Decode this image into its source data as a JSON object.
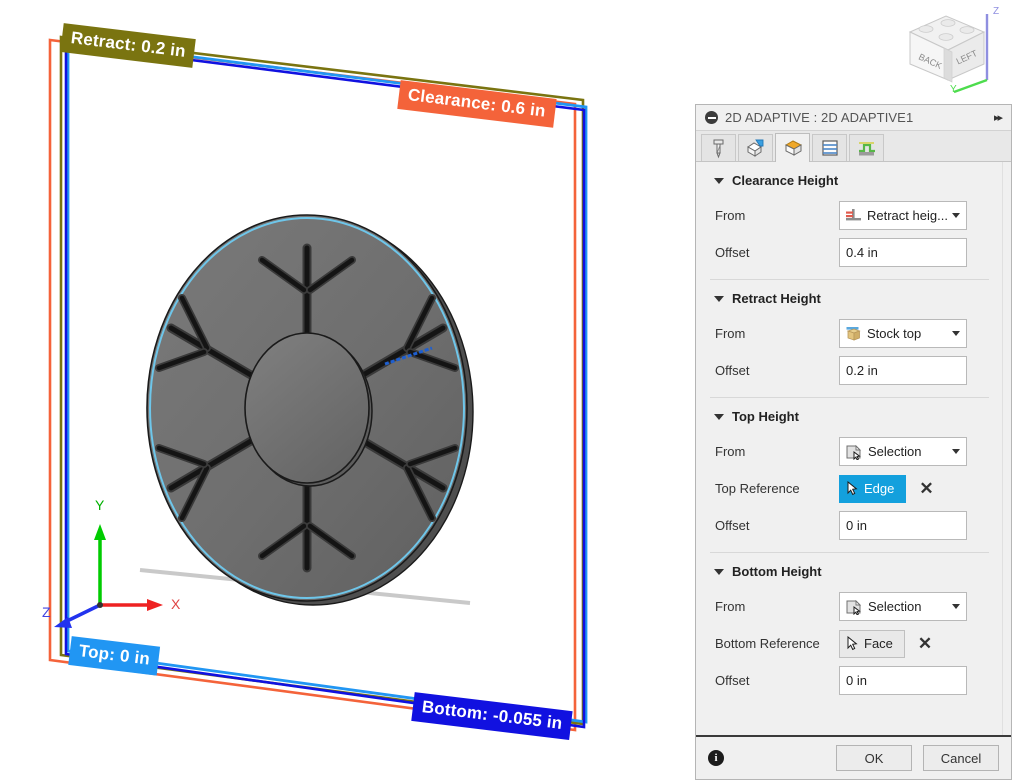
{
  "viewport": {
    "labels": [
      {
        "name": "retract-label",
        "text": "Retract: 0.2 in",
        "color": "#7a7410"
      },
      {
        "name": "clearance-label",
        "text": "Clearance: 0.6 in",
        "color": "#f4633a"
      },
      {
        "name": "top-label",
        "text": "Top: 0 in",
        "color": "#2196f3"
      },
      {
        "name": "bottom-label",
        "text": "Bottom: -0.055 in",
        "color": "#1111e0"
      }
    ],
    "axes": [
      {
        "name": "axis-y",
        "label": "Y",
        "color": "#00cc00"
      },
      {
        "name": "axis-x",
        "label": "X",
        "color": "#ee2222"
      },
      {
        "name": "axis-z",
        "label": "Z",
        "color": "#2233ee"
      }
    ],
    "boundary_colors": {
      "clearance": "#f4633a",
      "retract": "#7a7410",
      "top": "#2196f3",
      "bottom": "#1111e0"
    },
    "model": {
      "name": "hub-disc-part",
      "body_fill": "#6e6e6e",
      "edge_color": "#1a1a1a",
      "highlight_edge_color": "#1e5fd0"
    }
  },
  "viewcube": {
    "name": "view-cube",
    "faces": {
      "front_left": "BACK",
      "front_right": "LEFT"
    },
    "axis_labels": {
      "z": "Z",
      "y": "Y"
    },
    "z_color": "#8f8fe0",
    "y_color": "#4ddc4d"
  },
  "dialog": {
    "title": "2D ADAPTIVE : 2D ADAPTIVE1",
    "expand_glyph": "▸▸",
    "tabs": [
      {
        "id": "tool",
        "name": "tab-tool",
        "label": "Tool",
        "active": false
      },
      {
        "id": "geometry",
        "name": "tab-geometry",
        "label": "Geometry",
        "active": false
      },
      {
        "id": "heights",
        "name": "tab-heights",
        "label": "Heights",
        "active": true
      },
      {
        "id": "passes",
        "name": "tab-passes",
        "label": "Passes",
        "active": false
      },
      {
        "id": "linking",
        "name": "tab-linking",
        "label": "Linking",
        "active": false
      }
    ],
    "groups": [
      {
        "id": "clearance-height",
        "title": "Clearance Height",
        "rows": [
          {
            "kind": "combo",
            "label": "From",
            "value": "Retract heig...",
            "icon": "retract-height-icon"
          },
          {
            "kind": "input",
            "label": "Offset",
            "value": "0.4 in"
          }
        ]
      },
      {
        "id": "retract-height",
        "title": "Retract Height",
        "rows": [
          {
            "kind": "combo",
            "label": "From",
            "value": "Stock top",
            "icon": "stock-top-icon"
          },
          {
            "kind": "input",
            "label": "Offset",
            "value": "0.2 in"
          }
        ]
      },
      {
        "id": "top-height",
        "title": "Top Height",
        "rows": [
          {
            "kind": "combo",
            "label": "From",
            "value": "Selection",
            "icon": "selection-icon"
          },
          {
            "kind": "select",
            "label": "Top Reference",
            "value": "Edge",
            "selected": true,
            "icon": "cursor-icon",
            "clear": "✕"
          },
          {
            "kind": "input",
            "label": "Offset",
            "value": "0 in"
          }
        ]
      },
      {
        "id": "bottom-height",
        "title": "Bottom Height",
        "rows": [
          {
            "kind": "combo",
            "label": "From",
            "value": "Selection",
            "icon": "selection-icon"
          },
          {
            "kind": "select",
            "label": "Bottom Reference",
            "value": "Face",
            "selected": false,
            "icon": "cursor-icon",
            "clear": "✕"
          },
          {
            "kind": "input",
            "label": "Offset",
            "value": "0 in"
          }
        ]
      }
    ],
    "footer": {
      "info_glyph": "i",
      "ok_label": "OK",
      "cancel_label": "Cancel"
    },
    "accent_color": "#13a0dd"
  }
}
